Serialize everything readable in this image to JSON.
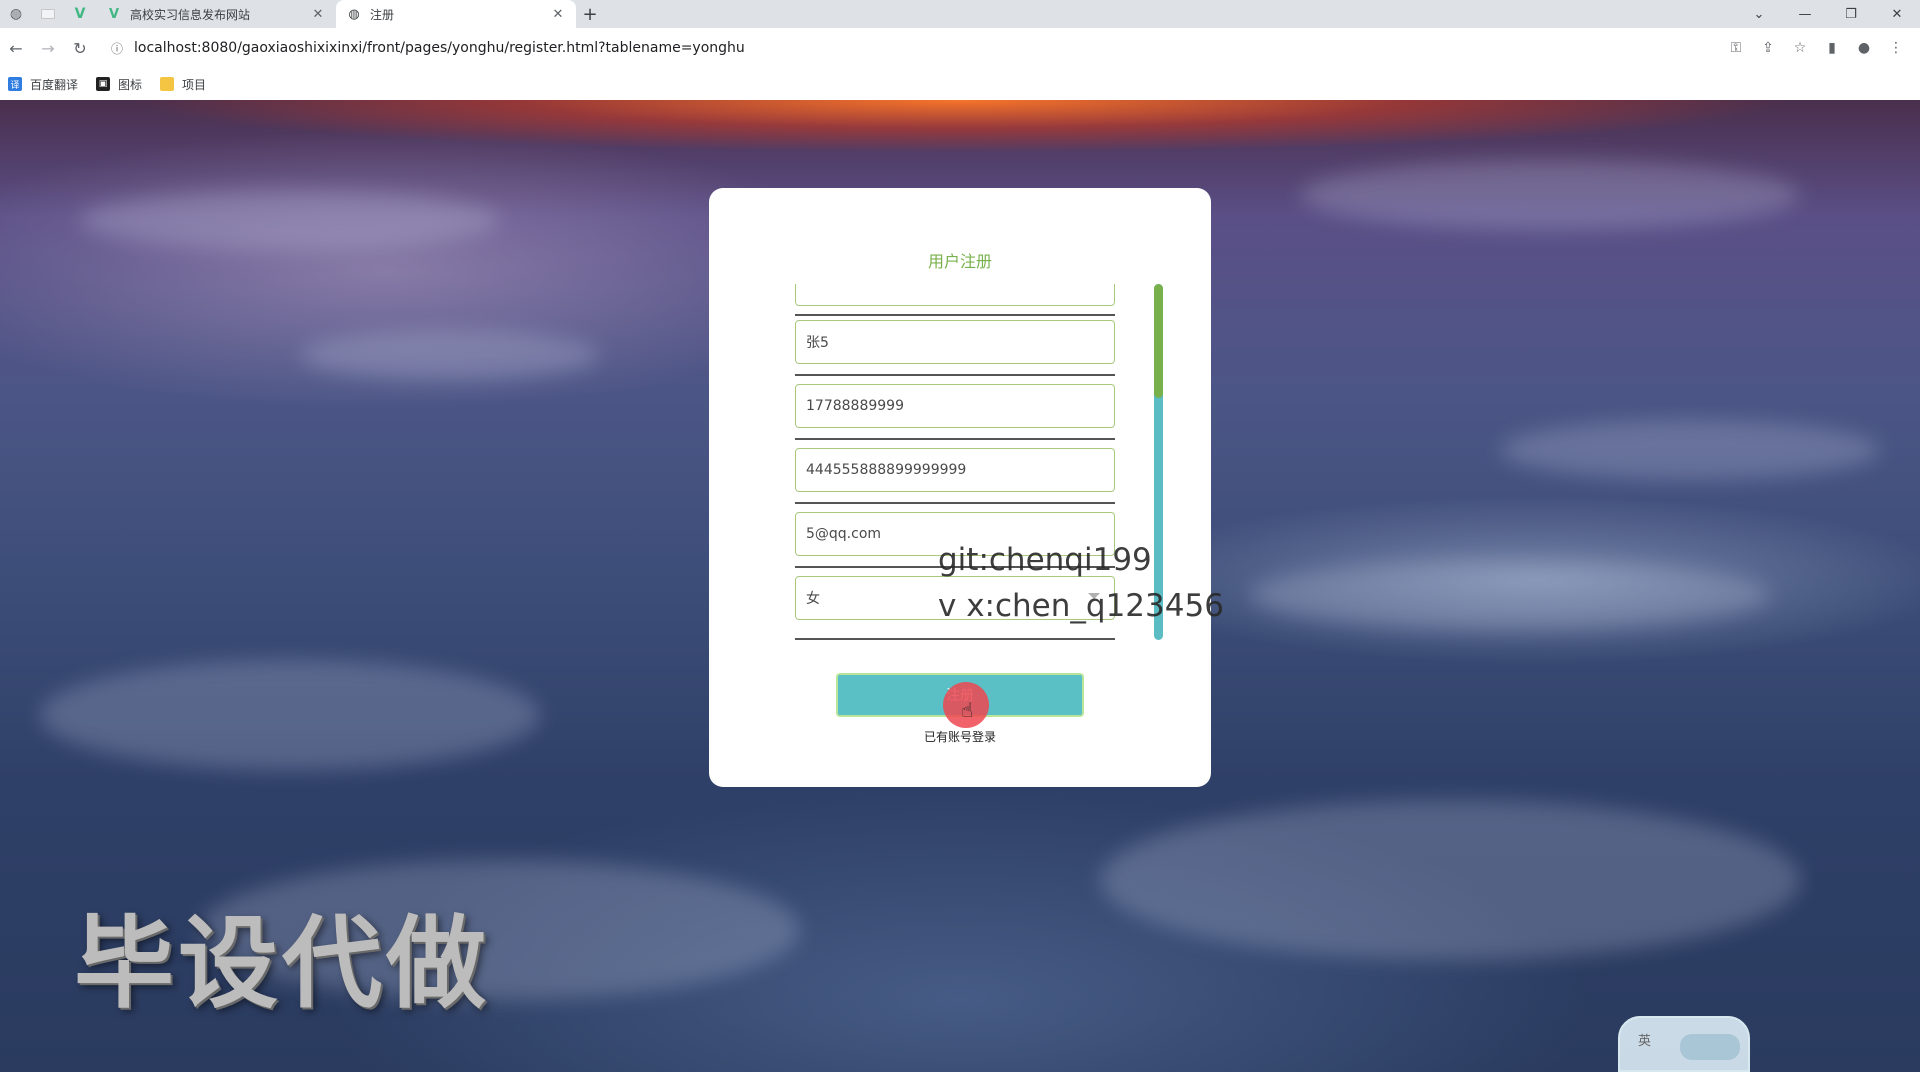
{
  "browser": {
    "tabs": [
      {
        "title": "高校实习信息发布网站",
        "active": false
      },
      {
        "title": "注册",
        "active": true
      }
    ],
    "new_tab_label": "+",
    "url": "localhost:8080/gaoxiaoshixixinxi/front/pages/yonghu/register.html?tablename=yonghu",
    "bookmarks": [
      {
        "label": "百度翻译",
        "color": "#2f7de1"
      },
      {
        "label": "图标",
        "color": "#222222"
      },
      {
        "label": "项目",
        "color": "#f4c542"
      }
    ]
  },
  "form": {
    "title": "用户注册",
    "fields": [
      {
        "name": "field-hidden-top",
        "value": ""
      },
      {
        "name": "name-field",
        "value": "张5"
      },
      {
        "name": "phone-field",
        "value": "17788889999"
      },
      {
        "name": "id-number-field",
        "value": "444555888899999999"
      },
      {
        "name": "email-field",
        "value": "5@qq.com"
      }
    ],
    "gender_select": {
      "value": "女"
    },
    "register_label": "注册",
    "login_link": "已有账号登录"
  },
  "watermarks": {
    "line1": "git:chenqi199",
    "line2": "v x:chen_q123456",
    "big": "毕设代做"
  },
  "ime": {
    "lang": "英"
  },
  "colors": {
    "accent_green": "#78b04b",
    "button_teal": "#5bbfc6"
  }
}
